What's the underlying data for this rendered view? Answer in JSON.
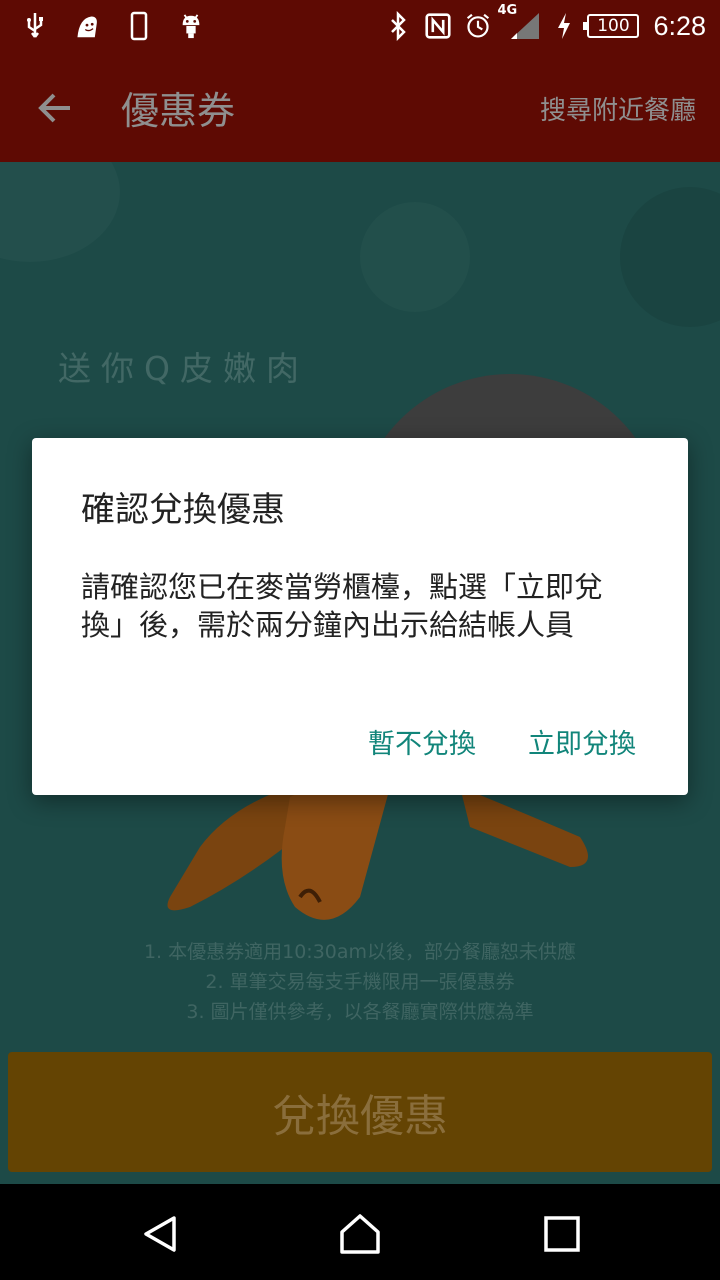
{
  "status_bar": {
    "icons_left": [
      "usb-icon",
      "ghost-icon",
      "phone-icon",
      "android-icon"
    ],
    "icons_right": [
      "bluetooth-icon",
      "nfc-icon",
      "alarm-icon",
      "signal-icon",
      "charging-icon"
    ],
    "network": "4G",
    "battery": "100",
    "time": "6:28"
  },
  "app_bar": {
    "title": "優惠券",
    "action": "搜尋附近餐廳"
  },
  "coupon": {
    "headline": "送你Q皮嫩肉",
    "terms": [
      "1. 本優惠券適用10:30am以後，部分餐廳恕未供應",
      "2. 單筆交易每支手機限用一張優惠券",
      "3. 圖片僅供參考，以各餐廳實際供應為準"
    ],
    "redeem_label": "兌換優惠"
  },
  "dialog": {
    "title": "確認兌換優惠",
    "message": "請確認您已在麥當勞櫃檯，點選「立即兌換」後，需於兩分鐘內出示給結帳人員",
    "cancel_label": "暫不兌換",
    "confirm_label": "立即兌換"
  },
  "colors": {
    "app_bar": "#5e0a03",
    "accent": "#11857a",
    "redeem_button": "#644403"
  }
}
